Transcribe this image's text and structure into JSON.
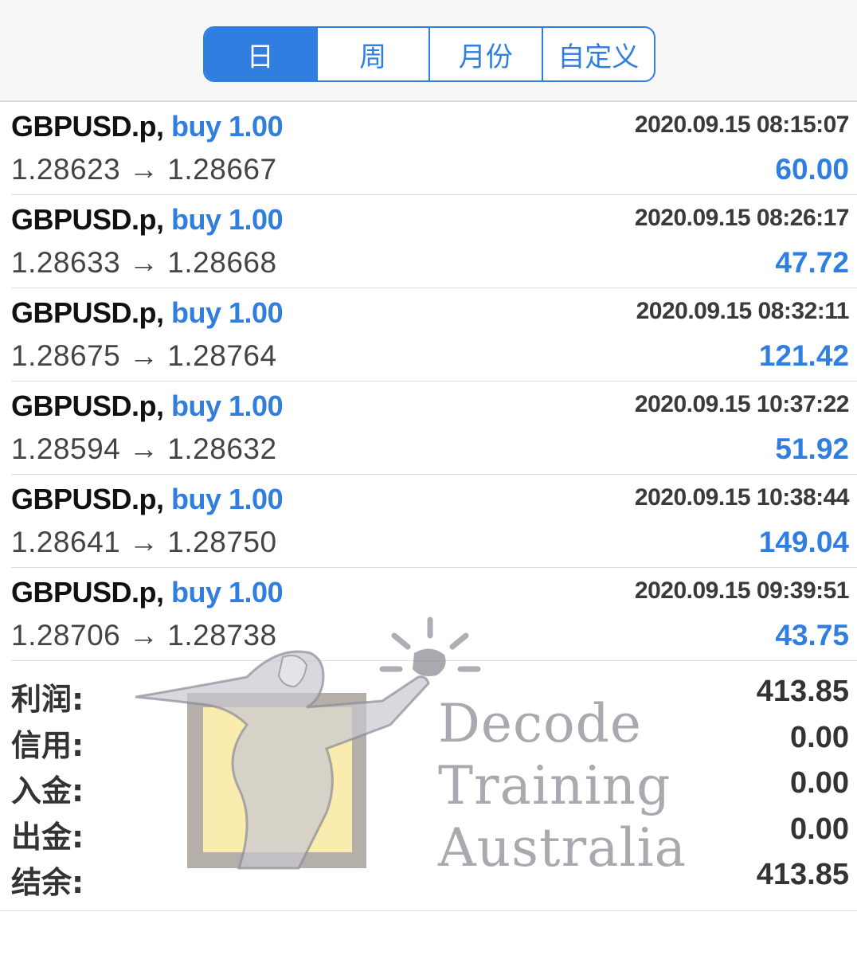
{
  "tabs": [
    {
      "label": "日",
      "active": true
    },
    {
      "label": "周",
      "active": false
    },
    {
      "label": "月份",
      "active": false
    },
    {
      "label": "自定义",
      "active": false
    }
  ],
  "trades": [
    {
      "symbol": "GBPUSD.p,",
      "side": "buy 1.00",
      "time": "2020.09.15 08:15:07",
      "prices": "1.28623 → 1.28667",
      "profit": "60.00"
    },
    {
      "symbol": "GBPUSD.p,",
      "side": "buy 1.00",
      "time": "2020.09.15 08:26:17",
      "prices": "1.28633 → 1.28668",
      "profit": "47.72"
    },
    {
      "symbol": "GBPUSD.p,",
      "side": "buy 1.00",
      "time": "2020.09.15 08:32:11",
      "prices": "1.28675 → 1.28764",
      "profit": "121.42"
    },
    {
      "symbol": "GBPUSD.p,",
      "side": "buy 1.00",
      "time": "2020.09.15 10:37:22",
      "prices": "1.28594 → 1.28632",
      "profit": "51.92"
    },
    {
      "symbol": "GBPUSD.p,",
      "side": "buy 1.00",
      "time": "2020.09.15 10:38:44",
      "prices": "1.28641 → 1.28750",
      "profit": "149.04"
    },
    {
      "symbol": "GBPUSD.p,",
      "side": "buy 1.00",
      "time": "2020.09.15 09:39:51",
      "prices": "1.28706 → 1.28738",
      "profit": "43.75"
    }
  ],
  "summary": [
    {
      "label": "利润:",
      "value": "413.85"
    },
    {
      "label": "信用:",
      "value": "0.00"
    },
    {
      "label": "入金:",
      "value": "0.00"
    },
    {
      "label": "出金:",
      "value": "0.00"
    },
    {
      "label": "结余:",
      "value": "413.85"
    }
  ],
  "watermark": {
    "lines": [
      "Decode",
      "Training",
      "Australia"
    ]
  },
  "colors": {
    "accent": "#2f7ee0",
    "text": "#111111",
    "muted": "#444444"
  }
}
